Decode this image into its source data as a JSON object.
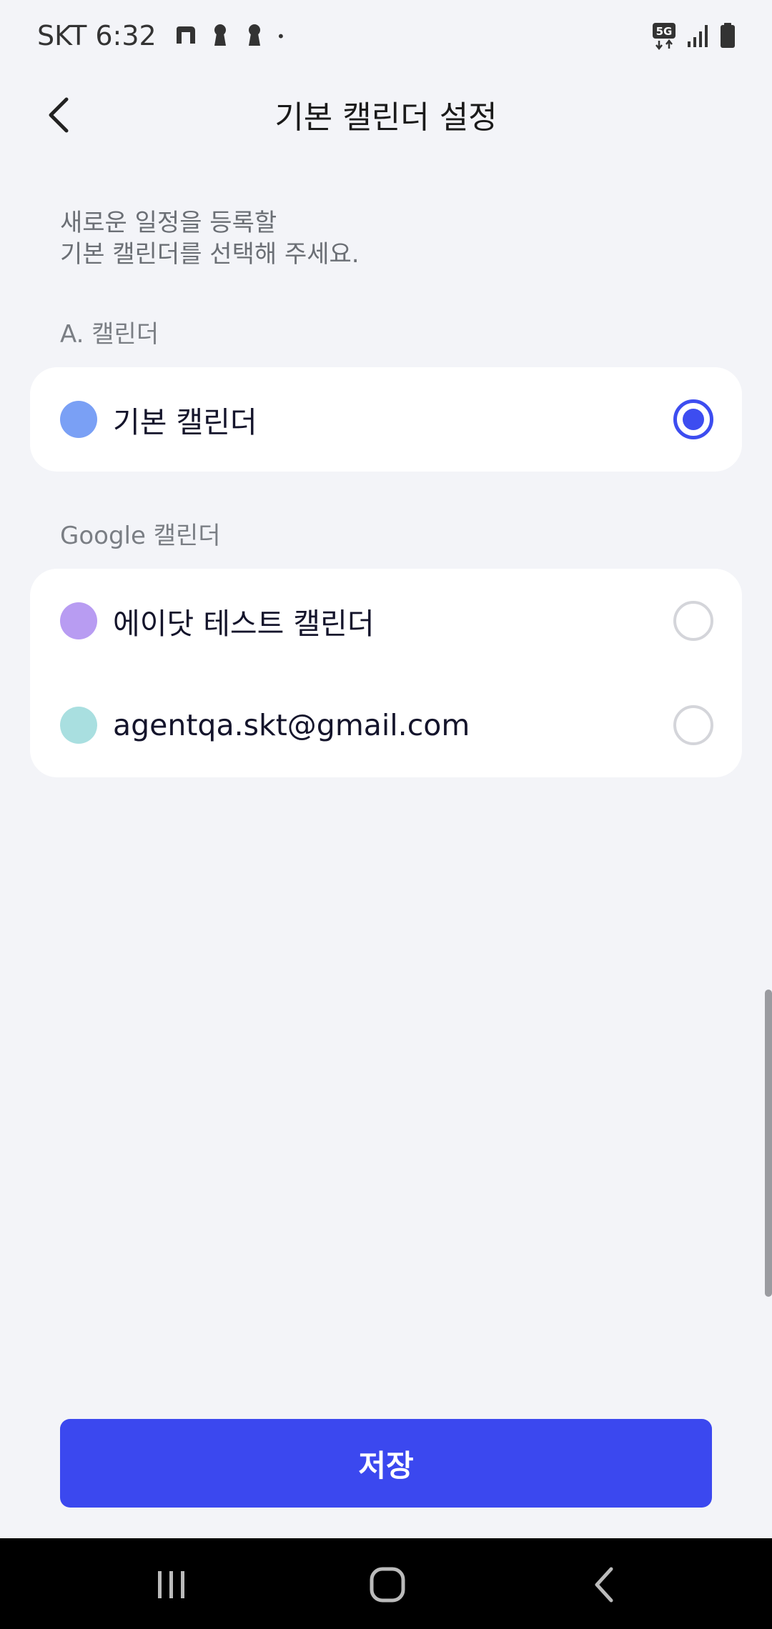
{
  "status_bar": {
    "carrier_time": "SKT 6:32",
    "network": "5G"
  },
  "header": {
    "title": "기본 캘린더 설정"
  },
  "description": {
    "line1": "새로운 일정을 등록할",
    "line2": "기본 캘린더를 선택해 주세요."
  },
  "sections": [
    {
      "label": "A. 캘린더",
      "items": [
        {
          "name": "기본 캘린더",
          "color": "#7aa0f5",
          "selected": true
        }
      ]
    },
    {
      "label": "Google 캘린더",
      "items": [
        {
          "name": "에이닷 테스트 캘린더",
          "color": "#b89cf2",
          "selected": false
        },
        {
          "name": "agentqa.skt@gmail.com",
          "color": "#a9dfe0",
          "selected": false
        }
      ]
    }
  ],
  "save_button": {
    "label": "저장"
  },
  "colors": {
    "accent": "#3b48ef",
    "background": "#f3f4f8"
  }
}
